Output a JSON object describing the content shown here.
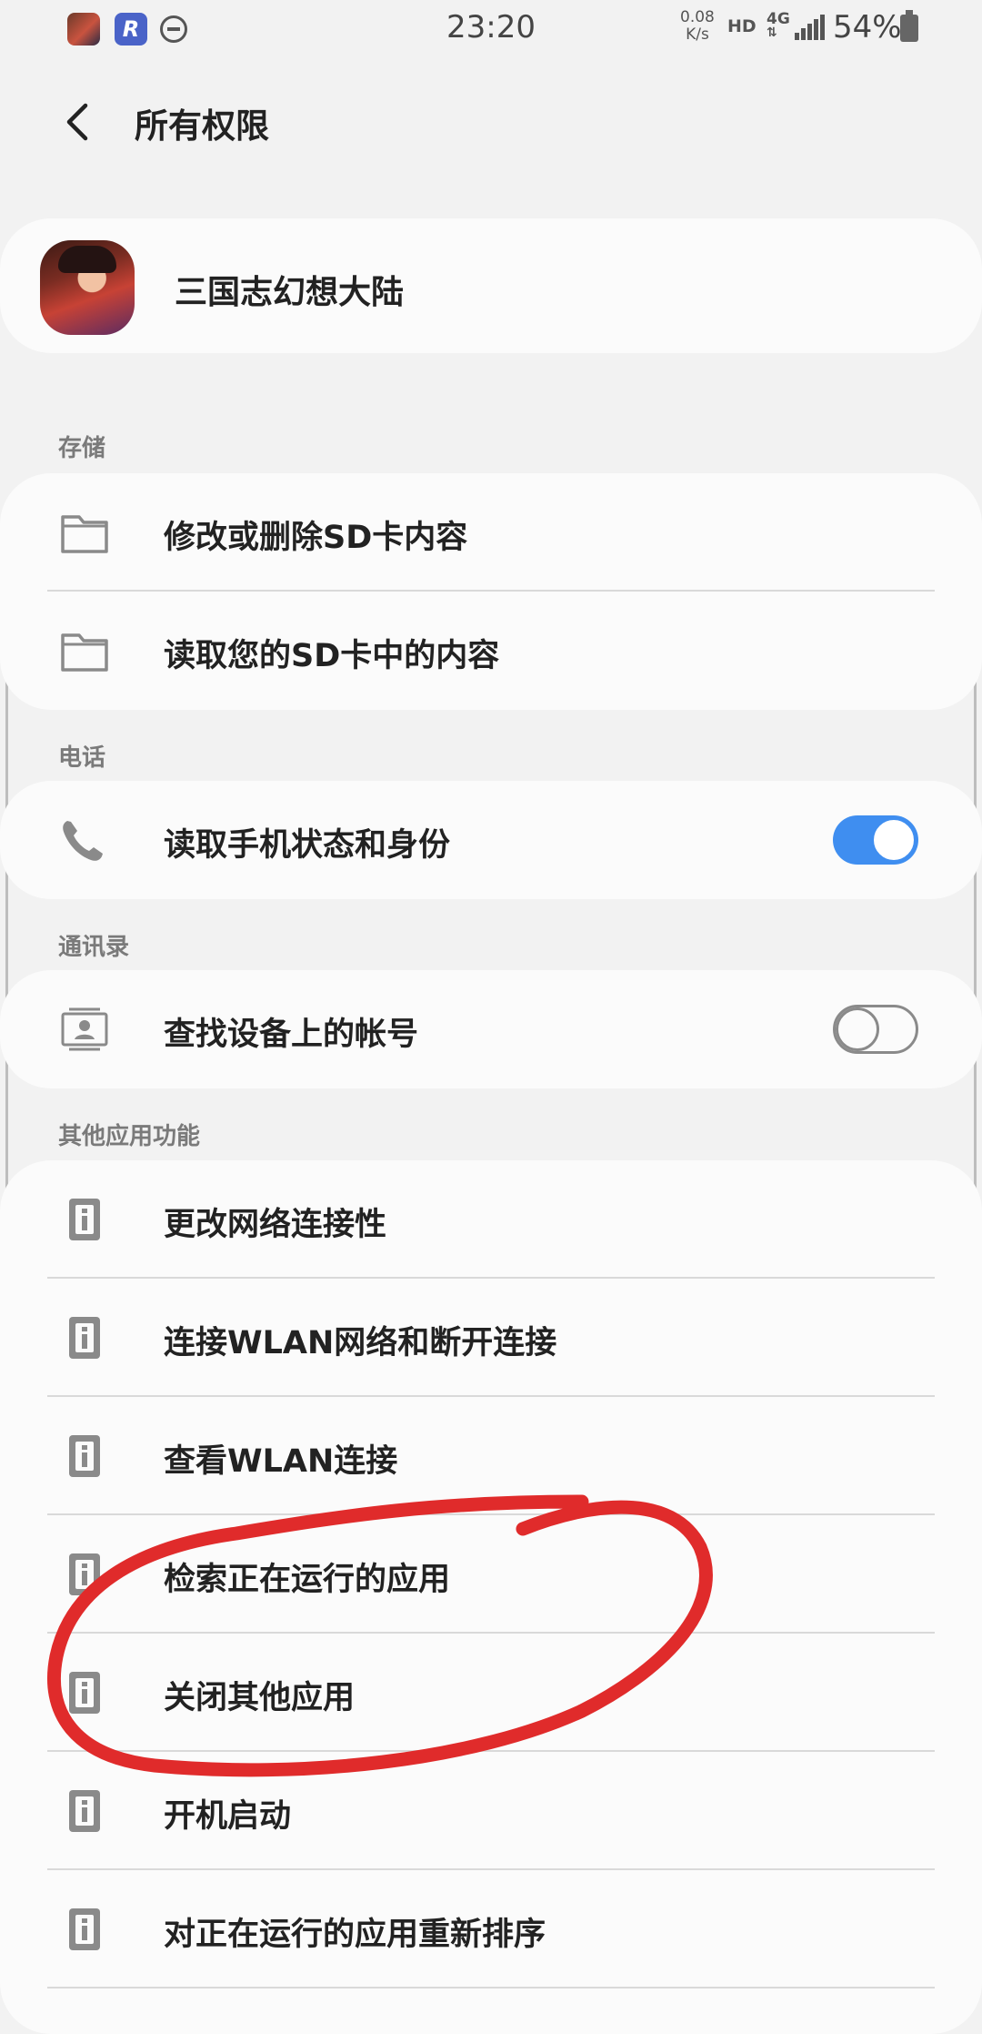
{
  "status_bar": {
    "time": "23:20",
    "net_speed_value": "0.08",
    "net_speed_unit": "K/s",
    "hd": "HD",
    "network": "4G",
    "battery": "54%"
  },
  "header": {
    "title": "所有权限"
  },
  "app": {
    "name": "三国志幻想大陆"
  },
  "sections": {
    "storage": {
      "label": "存储",
      "items": [
        {
          "label": "修改或删除SD卡内容",
          "icon": "folder-icon"
        },
        {
          "label": "读取您的SD卡中的内容",
          "icon": "folder-icon"
        }
      ]
    },
    "phone": {
      "label": "电话",
      "items": [
        {
          "label": "读取手机状态和身份",
          "icon": "phone-icon",
          "enabled": true
        }
      ]
    },
    "contacts": {
      "label": "通讯录",
      "items": [
        {
          "label": "查找设备上的帐号",
          "icon": "contact-card-icon",
          "enabled": false
        }
      ]
    },
    "other": {
      "label": "其他应用功能",
      "items": [
        {
          "label": "更改网络连接性",
          "icon": "info-icon"
        },
        {
          "label": "连接WLAN网络和断开连接",
          "icon": "info-icon"
        },
        {
          "label": "查看WLAN连接",
          "icon": "info-icon"
        },
        {
          "label": "检索正在运行的应用",
          "icon": "info-icon"
        },
        {
          "label": "关闭其他应用",
          "icon": "info-icon"
        },
        {
          "label": "开机启动",
          "icon": "info-icon"
        },
        {
          "label": "对正在运行的应用重新排序",
          "icon": "info-icon"
        }
      ]
    }
  },
  "colors": {
    "toggle_on": "#3f8ef0",
    "annotation_red": "#e02b2b",
    "background": "#f2f2f2",
    "card": "#fbfbfb"
  }
}
